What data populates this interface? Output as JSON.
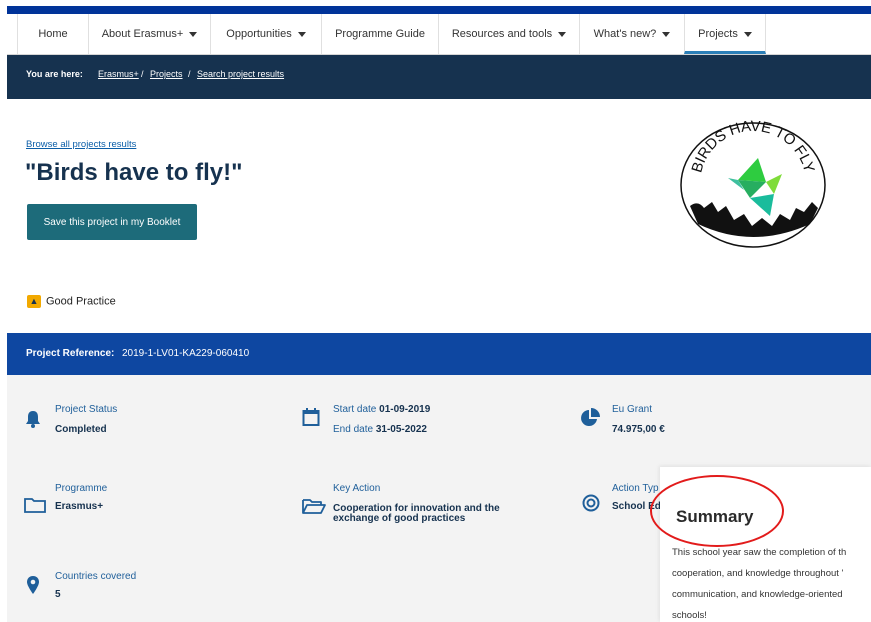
{
  "nav": {
    "items": [
      {
        "label": "Home",
        "dropdown": false
      },
      {
        "label": "About Erasmus+",
        "dropdown": true
      },
      {
        "label": "Opportunities",
        "dropdown": true
      },
      {
        "label": "Programme Guide",
        "dropdown": false
      },
      {
        "label": "Resources and tools",
        "dropdown": true
      },
      {
        "label": "What's new?",
        "dropdown": true
      },
      {
        "label": "Projects",
        "dropdown": true,
        "active": true
      }
    ]
  },
  "breadcrumb": {
    "label": "You are here:",
    "items": [
      "Erasmus+",
      "Projects",
      "Search project results"
    ],
    "separator": "/"
  },
  "project": {
    "browse_link": "Browse all projects results",
    "title": "\"Birds have to fly!\"",
    "save_button": "Save this project in my Booklet",
    "badge": "Good Practice",
    "logo_text": "BIRDS HAVE TO FLY"
  },
  "reference": {
    "label": "Project Reference:",
    "value": "2019-1-LV01-KA229-060410"
  },
  "details": {
    "status_label": "Project Status",
    "status_value": "Completed",
    "start_label": "Start date",
    "start_value": "01-09-2019",
    "end_label": "End date",
    "end_value": "31-05-2022",
    "grant_label": "Eu Grant",
    "grant_value": "74.975,00 €",
    "programme_label": "Programme",
    "programme_value": "Erasmus+",
    "key_action_label": "Key Action",
    "key_action_line1": "Cooperation for innovation and the",
    "key_action_line2": "exchange of good practices",
    "action_type_label": "Action Typ",
    "action_type_value": "School Ed",
    "countries_label": "Countries covered",
    "countries_value": "5"
  },
  "summary": {
    "heading": "Summary",
    "lines": [
      "This school year saw the completion of th",
      "cooperation, and knowledge throughout '",
      "communication, and knowledge-oriented",
      "schools!"
    ]
  },
  "colors": {
    "top_bar": "#003399",
    "breadcrumb_bar": "#16324f",
    "reference_bar": "#0e47a1",
    "save_button": "#1d6b7a",
    "badge": "#f2a900",
    "annotation_circle": "#e21b1b"
  }
}
